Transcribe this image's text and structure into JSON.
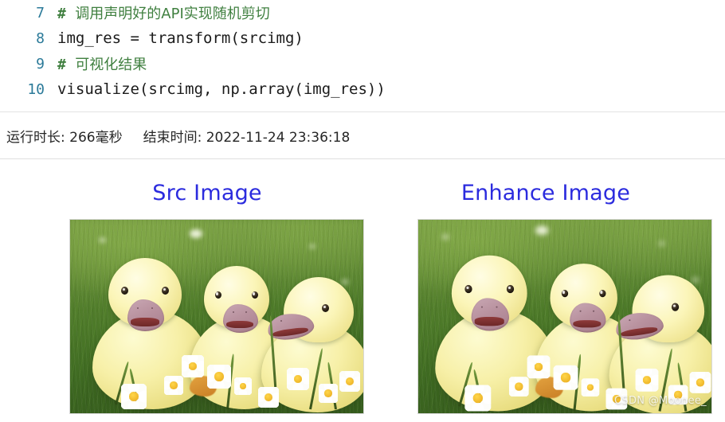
{
  "notebook": {
    "lines": [
      {
        "number": "7",
        "hash": "#",
        "text": "调用声明好的API实现随机剪切",
        "type": "comment"
      },
      {
        "number": "8",
        "text": "img_res = transform(srcimg)",
        "type": "code"
      },
      {
        "number": "9",
        "hash": "#",
        "text": "可视化结果",
        "type": "comment"
      },
      {
        "number": "10",
        "text": "visualize(srcimg, np.array(img_res))",
        "type": "code"
      }
    ]
  },
  "runbar": {
    "duration": "运行时长: 266毫秒",
    "end_time": "结束时间: 2022-11-24 23:36:18"
  },
  "figure": {
    "left_title": "Src Image",
    "right_title": "Enhance Image",
    "title_color": "#2b2bde",
    "image_alt_left": "three yellow ducklings sitting in green grass with white daisies",
    "image_alt_right": "three yellow ducklings sitting in green grass with white daisies (randomly cropped)"
  },
  "watermark": {
    "text": "CSDN @Moonee_"
  }
}
